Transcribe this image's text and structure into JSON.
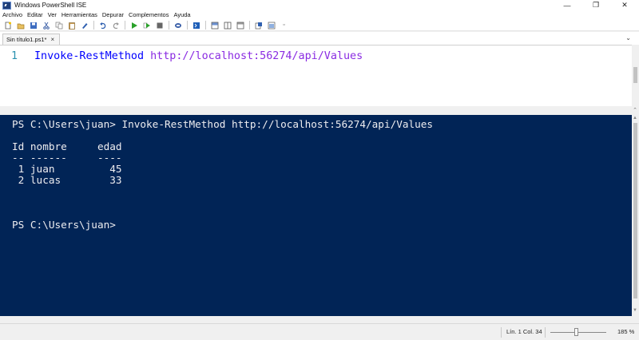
{
  "window": {
    "title": "Windows PowerShell ISE",
    "controls": [
      "—",
      "❐",
      "✕"
    ]
  },
  "menu": [
    {
      "label": "Archivo"
    },
    {
      "label": "Editar"
    },
    {
      "label": "Ver"
    },
    {
      "label": "Herramientas"
    },
    {
      "label": "Depurar"
    },
    {
      "label": "Complementos"
    },
    {
      "label": "Ayuda"
    }
  ],
  "toolbar": {
    "icons": [
      "new-icon",
      "open-icon",
      "save-icon",
      "cut-icon",
      "copy-icon",
      "paste-icon",
      "clear-icon",
      "undo-icon",
      "redo-icon",
      "run-icon",
      "run-selection-icon",
      "stop-icon",
      "remote-icon",
      "command-window-icon",
      "layout-top-icon",
      "layout-right-icon",
      "layout-max-icon",
      "show-commands-icon",
      "addon-icon"
    ],
    "overflow": "▫"
  },
  "tabs": [
    {
      "label": "Sin título1.ps1*",
      "close": "×"
    }
  ],
  "script": {
    "lines": [
      {
        "number": "1",
        "cmdlet": "Invoke-RestMethod",
        "argument": " http://localhost:56274/api/Values"
      }
    ]
  },
  "console": {
    "lines": [
      "PS C:\\Users\\juan> Invoke-RestMethod http://localhost:56274/api/Values",
      "",
      "Id nombre     edad",
      "-- ------     ----",
      " 1 juan         45",
      " 2 lucas        33",
      "",
      "",
      "",
      "PS C:\\Users\\juan>"
    ]
  },
  "status": {
    "position": "Lín. 1  Col. 34",
    "zoom": "185 %"
  }
}
